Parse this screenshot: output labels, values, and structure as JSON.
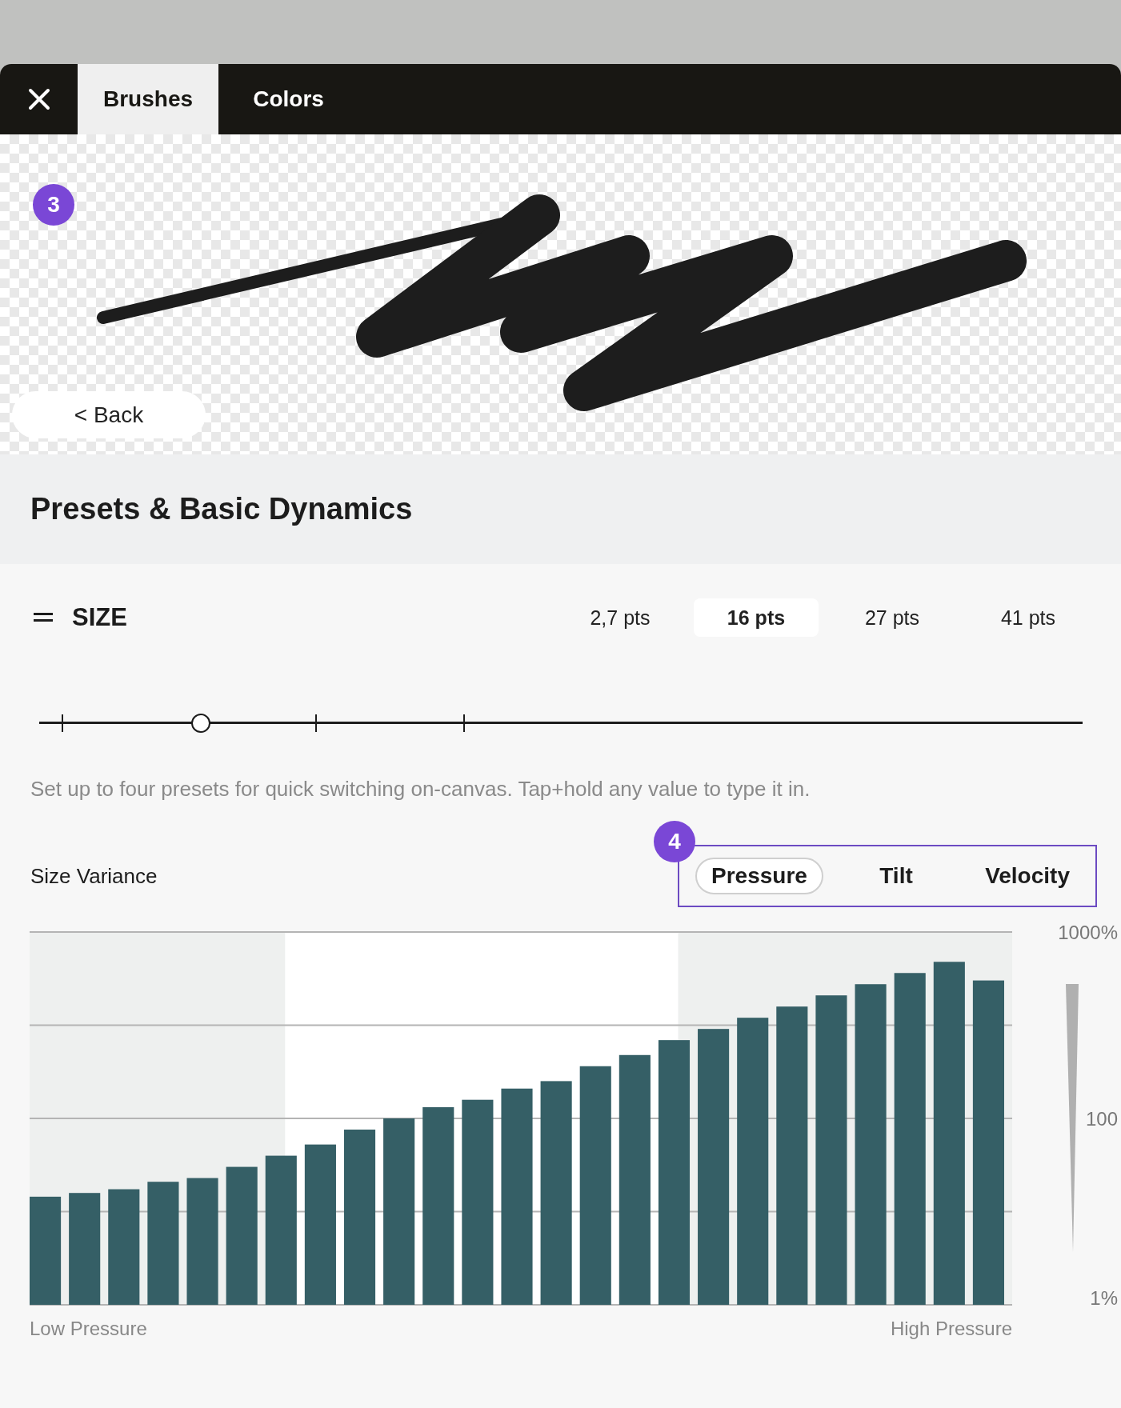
{
  "tabs": [
    {
      "label": "Brushes",
      "selected": true
    },
    {
      "label": "Colors",
      "selected": false
    }
  ],
  "preview": {
    "callout": "3",
    "back_button": "< Back"
  },
  "section_title": "Presets & Basic Dynamics",
  "size": {
    "label": "SIZE",
    "presets": [
      {
        "value": "2,7 pts",
        "selected": false,
        "level": 0.022
      },
      {
        "value": "16 pts",
        "selected": true,
        "level": 0.155
      },
      {
        "value": "27 pts",
        "selected": false,
        "level": 0.265
      },
      {
        "value": "41 pts",
        "selected": false,
        "level": 0.407
      }
    ],
    "hint": "Set up to four presets for quick switching on-canvas. Tap+hold any value to type it in."
  },
  "size_variance": {
    "label": "Size Variance",
    "callout": "4",
    "modes": [
      {
        "label": "Pressure",
        "selected": true
      },
      {
        "label": "Tilt",
        "selected": false
      },
      {
        "label": "Velocity",
        "selected": false
      }
    ],
    "y_axis_labels": [
      "1000%",
      "100",
      "1%"
    ],
    "x_axis_labels": [
      "Low Pressure",
      "High Pressure"
    ]
  }
}
